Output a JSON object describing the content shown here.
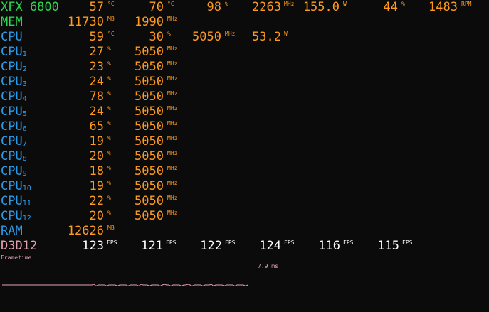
{
  "gpu": {
    "label": "XFX 6800",
    "temp": "57",
    "temp_unit": "°C",
    "hotspot": "70",
    "hotspot_unit": "°C",
    "load": "98",
    "load_unit": "%",
    "clock": "2263",
    "clock_unit": "MHz",
    "power": "155.0",
    "power_unit": "W",
    "fan_pct": "44",
    "fan_pct_unit": "%",
    "fan_rpm": "1483",
    "fan_rpm_unit": "RPM"
  },
  "mem": {
    "label": "MEM",
    "used": "11730",
    "used_unit": "MB",
    "clock": "1990",
    "clock_unit": "MHz"
  },
  "cpu": {
    "label": "CPU",
    "temp": "59",
    "temp_unit": "°C",
    "load": "30",
    "load_unit": "%",
    "clock": "5050",
    "clock_unit": "MHz",
    "power": "53.2",
    "power_unit": "W"
  },
  "cores": [
    {
      "label": "CPU",
      "index": "1",
      "load": "27",
      "load_unit": "%",
      "clock": "5050",
      "clock_unit": "MHz"
    },
    {
      "label": "CPU",
      "index": "2",
      "load": "23",
      "load_unit": "%",
      "clock": "5050",
      "clock_unit": "MHz"
    },
    {
      "label": "CPU",
      "index": "3",
      "load": "24",
      "load_unit": "%",
      "clock": "5050",
      "clock_unit": "MHz"
    },
    {
      "label": "CPU",
      "index": "4",
      "load": "78",
      "load_unit": "%",
      "clock": "5050",
      "clock_unit": "MHz"
    },
    {
      "label": "CPU",
      "index": "5",
      "load": "24",
      "load_unit": "%",
      "clock": "5050",
      "clock_unit": "MHz"
    },
    {
      "label": "CPU",
      "index": "6",
      "load": "65",
      "load_unit": "%",
      "clock": "5050",
      "clock_unit": "MHz"
    },
    {
      "label": "CPU",
      "index": "7",
      "load": "19",
      "load_unit": "%",
      "clock": "5050",
      "clock_unit": "MHz"
    },
    {
      "label": "CPU",
      "index": "8",
      "load": "20",
      "load_unit": "%",
      "clock": "5050",
      "clock_unit": "MHz"
    },
    {
      "label": "CPU",
      "index": "9",
      "load": "18",
      "load_unit": "%",
      "clock": "5050",
      "clock_unit": "MHz"
    },
    {
      "label": "CPU",
      "index": "10",
      "load": "19",
      "load_unit": "%",
      "clock": "5050",
      "clock_unit": "MHz"
    },
    {
      "label": "CPU",
      "index": "11",
      "load": "22",
      "load_unit": "%",
      "clock": "5050",
      "clock_unit": "MHz"
    },
    {
      "label": "CPU",
      "index": "12",
      "load": "20",
      "load_unit": "%",
      "clock": "5050",
      "clock_unit": "MHz"
    }
  ],
  "ram": {
    "label": "RAM",
    "used": "12626",
    "used_unit": "MB"
  },
  "d3d": {
    "label": "D3D12",
    "fps": [
      {
        "value": "123",
        "unit": "FPS"
      },
      {
        "value": "121",
        "unit": "FPS"
      },
      {
        "value": "122",
        "unit": "FPS"
      },
      {
        "value": "124",
        "unit": "FPS"
      },
      {
        "value": "116",
        "unit": "FPS"
      },
      {
        "value": "115",
        "unit": "FPS"
      }
    ]
  },
  "frametime": {
    "label": "Frametime",
    "ms": "7.9 ms"
  },
  "colors": {
    "gpu_label": "#2bd64c",
    "cpu_label": "#2b9be8",
    "value": "#ff9a1e",
    "d3d_label": "#e6a2b4",
    "fps_value": "#ffffff",
    "background": "#0b0b0b"
  }
}
